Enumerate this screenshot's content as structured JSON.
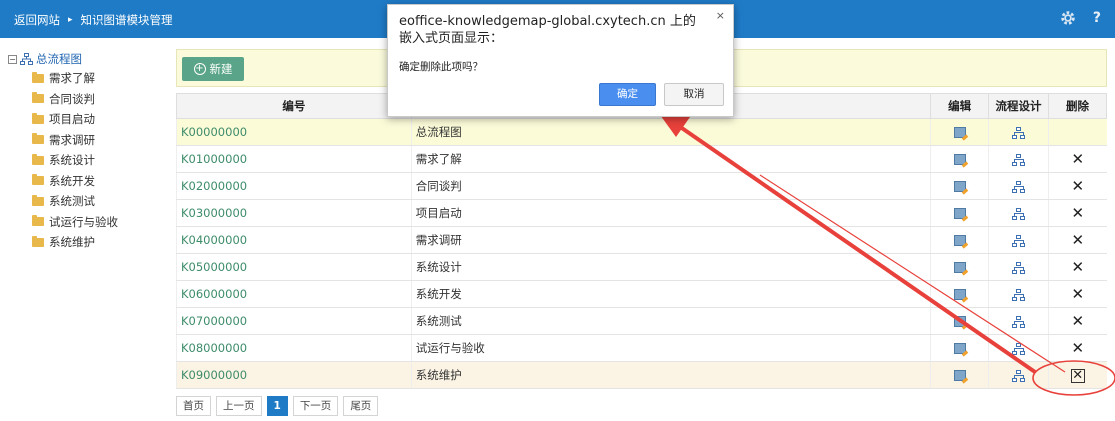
{
  "topbar": {
    "back_label": "返回网站",
    "separator": "▸",
    "title": "知识图谱模块管理",
    "help_label": "?"
  },
  "tree": {
    "toggle": "−",
    "root_label": "总流程图",
    "items": [
      "需求了解",
      "合同谈判",
      "项目启动",
      "需求调研",
      "系统设计",
      "系统开发",
      "系统测试",
      "试运行与验收",
      "系统维护"
    ]
  },
  "toolbar": {
    "new_label": "新建",
    "new_icon": "+"
  },
  "table": {
    "headers": {
      "code": "编号",
      "name": "",
      "edit": "编辑",
      "flow": "流程设计",
      "del": "删除"
    },
    "rows": [
      {
        "code": "K00000000",
        "name": "总流程图"
      },
      {
        "code": "K01000000",
        "name": "需求了解"
      },
      {
        "code": "K02000000",
        "name": "合同谈判"
      },
      {
        "code": "K03000000",
        "name": "项目启动"
      },
      {
        "code": "K04000000",
        "name": "需求调研"
      },
      {
        "code": "K05000000",
        "name": "系统设计"
      },
      {
        "code": "K06000000",
        "name": "系统开发"
      },
      {
        "code": "K07000000",
        "name": "系统测试"
      },
      {
        "code": "K08000000",
        "name": "试运行与验收"
      },
      {
        "code": "K09000000",
        "name": "系统维护"
      }
    ],
    "delete_glyph": "✕"
  },
  "pager": {
    "first": "首页",
    "prev": "上一页",
    "current": "1",
    "next": "下一页",
    "last": "尾页"
  },
  "dialog": {
    "title": "eoffice-knowledgemap-global.cxytech.cn 上的嵌入式页面显示：",
    "close": "×",
    "message": "确定删除此项吗？",
    "ok_label": "确定",
    "cancel_label": "取消"
  },
  "colors": {
    "topbar": "#1f7bc6",
    "accent_green": "#5aa58a",
    "code_text": "#3d8c6a",
    "annotation": "#e8413b"
  }
}
